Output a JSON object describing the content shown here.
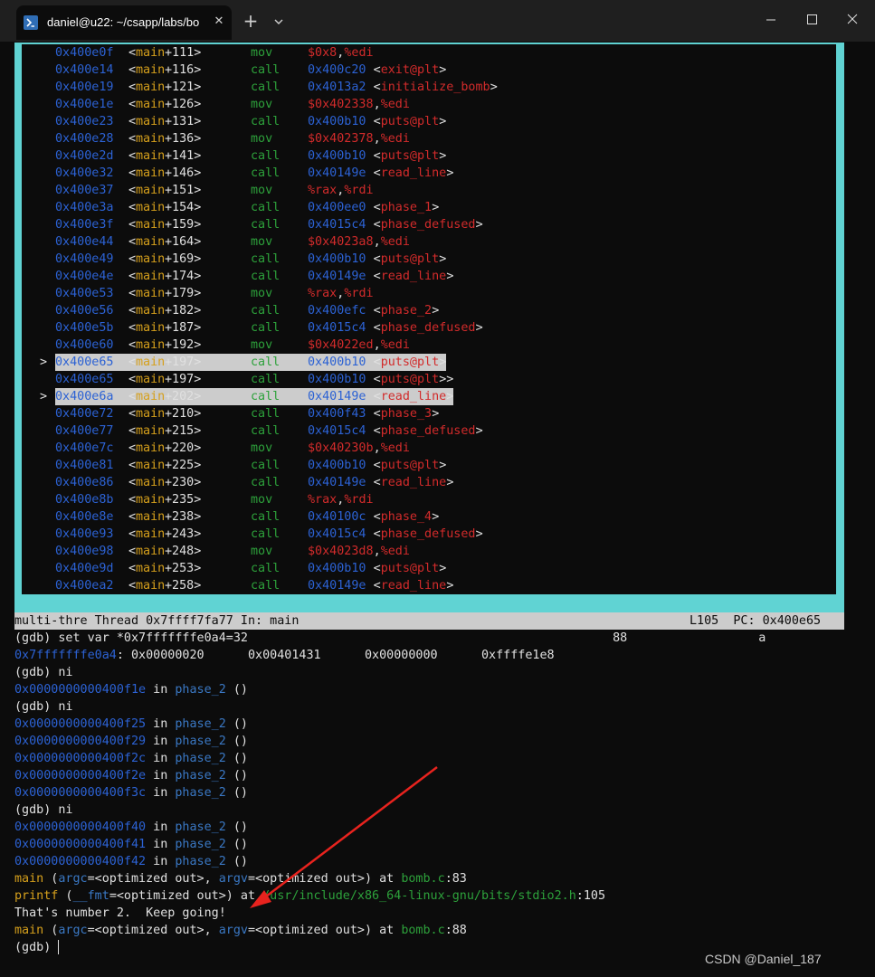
{
  "window": {
    "tab_title": "daniel@u22: ~/csapp/labs/bo",
    "new_tab_label": "+",
    "tab_close": "✕"
  },
  "asm_lines": [
    {
      "marker": "",
      "addr": "0x400e0f",
      "fn": "main",
      "off": "+111",
      "op": "mov",
      "args": [
        [
          "reg",
          "$0x8"
        ],
        [
          "w",
          ","
        ],
        [
          "reg",
          "%edi"
        ]
      ],
      "hl": false
    },
    {
      "marker": "",
      "addr": "0x400e14",
      "fn": "main",
      "off": "+116",
      "op": "call",
      "args": [
        [
          "addr",
          "0x400c20"
        ],
        [
          "w",
          " <"
        ],
        [
          "sym",
          "exit@plt"
        ],
        [
          "w",
          ">"
        ]
      ],
      "hl": false
    },
    {
      "marker": "",
      "addr": "0x400e19",
      "fn": "main",
      "off": "+121",
      "op": "call",
      "args": [
        [
          "addr",
          "0x4013a2"
        ],
        [
          "w",
          " <"
        ],
        [
          "sym",
          "initialize_bomb"
        ],
        [
          "w",
          ">"
        ]
      ],
      "hl": false
    },
    {
      "marker": "",
      "addr": "0x400e1e",
      "fn": "main",
      "off": "+126",
      "op": "mov",
      "args": [
        [
          "reg",
          "$0x402338"
        ],
        [
          "w",
          ","
        ],
        [
          "reg",
          "%edi"
        ]
      ],
      "hl": false
    },
    {
      "marker": "",
      "addr": "0x400e23",
      "fn": "main",
      "off": "+131",
      "op": "call",
      "args": [
        [
          "addr",
          "0x400b10"
        ],
        [
          "w",
          " <"
        ],
        [
          "sym",
          "puts@plt"
        ],
        [
          "w",
          ">"
        ]
      ],
      "hl": false
    },
    {
      "marker": "",
      "addr": "0x400e28",
      "fn": "main",
      "off": "+136",
      "op": "mov",
      "args": [
        [
          "reg",
          "$0x402378"
        ],
        [
          "w",
          ","
        ],
        [
          "reg",
          "%edi"
        ]
      ],
      "hl": false
    },
    {
      "marker": "",
      "addr": "0x400e2d",
      "fn": "main",
      "off": "+141",
      "op": "call",
      "args": [
        [
          "addr",
          "0x400b10"
        ],
        [
          "w",
          " <"
        ],
        [
          "sym",
          "puts@plt"
        ],
        [
          "w",
          ">"
        ]
      ],
      "hl": false
    },
    {
      "marker": "",
      "addr": "0x400e32",
      "fn": "main",
      "off": "+146",
      "op": "call",
      "args": [
        [
          "addr",
          "0x40149e"
        ],
        [
          "w",
          " <"
        ],
        [
          "sym",
          "read_line"
        ],
        [
          "w",
          ">"
        ]
      ],
      "hl": false
    },
    {
      "marker": "",
      "addr": "0x400e37",
      "fn": "main",
      "off": "+151",
      "op": "mov",
      "args": [
        [
          "reg",
          "%rax"
        ],
        [
          "w",
          ","
        ],
        [
          "reg",
          "%rdi"
        ]
      ],
      "hl": false
    },
    {
      "marker": "",
      "addr": "0x400e3a",
      "fn": "main",
      "off": "+154",
      "op": "call",
      "args": [
        [
          "addr",
          "0x400ee0"
        ],
        [
          "w",
          " <"
        ],
        [
          "sym",
          "phase_1"
        ],
        [
          "w",
          ">"
        ]
      ],
      "hl": false
    },
    {
      "marker": "",
      "addr": "0x400e3f",
      "fn": "main",
      "off": "+159",
      "op": "call",
      "args": [
        [
          "addr",
          "0x4015c4"
        ],
        [
          "w",
          " <"
        ],
        [
          "sym",
          "phase_defused"
        ],
        [
          "w",
          ">"
        ]
      ],
      "hl": false
    },
    {
      "marker": "",
      "addr": "0x400e44",
      "fn": "main",
      "off": "+164",
      "op": "mov",
      "args": [
        [
          "reg",
          "$0x4023a8"
        ],
        [
          "w",
          ","
        ],
        [
          "reg",
          "%edi"
        ]
      ],
      "hl": false
    },
    {
      "marker": "",
      "addr": "0x400e49",
      "fn": "main",
      "off": "+169",
      "op": "call",
      "args": [
        [
          "addr",
          "0x400b10"
        ],
        [
          "w",
          " <"
        ],
        [
          "sym",
          "puts@plt"
        ],
        [
          "w",
          ">"
        ]
      ],
      "hl": false
    },
    {
      "marker": "",
      "addr": "0x400e4e",
      "fn": "main",
      "off": "+174",
      "op": "call",
      "args": [
        [
          "addr",
          "0x40149e"
        ],
        [
          "w",
          " <"
        ],
        [
          "sym",
          "read_line"
        ],
        [
          "w",
          ">"
        ]
      ],
      "hl": false
    },
    {
      "marker": "",
      "addr": "0x400e53",
      "fn": "main",
      "off": "+179",
      "op": "mov",
      "args": [
        [
          "reg",
          "%rax"
        ],
        [
          "w",
          ","
        ],
        [
          "reg",
          "%rdi"
        ]
      ],
      "hl": false
    },
    {
      "marker": "",
      "addr": "0x400e56",
      "fn": "main",
      "off": "+182",
      "op": "call",
      "args": [
        [
          "addr",
          "0x400efc"
        ],
        [
          "w",
          " <"
        ],
        [
          "sym",
          "phase_2"
        ],
        [
          "w",
          ">"
        ]
      ],
      "hl": false
    },
    {
      "marker": "",
      "addr": "0x400e5b",
      "fn": "main",
      "off": "+187",
      "op": "call",
      "args": [
        [
          "addr",
          "0x4015c4"
        ],
        [
          "w",
          " <"
        ],
        [
          "sym",
          "phase_defused"
        ],
        [
          "w",
          ">"
        ]
      ],
      "hl": false
    },
    {
      "marker": "",
      "addr": "0x400e60",
      "fn": "main",
      "off": "+192",
      "op": "mov",
      "args": [
        [
          "reg",
          "$0x4022ed"
        ],
        [
          "w",
          ","
        ],
        [
          "reg",
          "%edi"
        ]
      ],
      "hl": false
    },
    {
      "marker": ">",
      "addr": "0x400e65",
      "fn": "main",
      "off": "+197",
      "op": "call",
      "args": [
        [
          "addr",
          "0x400b10"
        ],
        [
          "w",
          " <"
        ],
        [
          "sym",
          "puts@plt"
        ],
        [
          "w",
          ">"
        ]
      ],
      "hl": true
    },
    {
      "marker": "",
      "addr": "0x400e65",
      "fn": "main",
      "off": "+197",
      "op": "call",
      "args": [
        [
          "addr",
          "0x400b10"
        ],
        [
          "w",
          " <"
        ],
        [
          "sym",
          "puts@plt"
        ],
        [
          "w",
          ">>"
        ]
      ],
      "hl": false
    },
    {
      "marker": ">",
      "addr": "0x400e6a",
      "fn": "main",
      "off": "+202",
      "op": "call",
      "args": [
        [
          "addr",
          "0x40149e"
        ],
        [
          "w",
          " <"
        ],
        [
          "sym",
          "read_line"
        ],
        [
          "w",
          ">"
        ]
      ],
      "hl": true
    },
    {
      "marker": "",
      "addr": "0x400e72",
      "fn": "main",
      "off": "+210",
      "op": "call",
      "args": [
        [
          "addr",
          "0x400f43"
        ],
        [
          "w",
          " <"
        ],
        [
          "sym",
          "phase_3"
        ],
        [
          "w",
          ">"
        ]
      ],
      "hl": false
    },
    {
      "marker": "",
      "addr": "0x400e77",
      "fn": "main",
      "off": "+215",
      "op": "call",
      "args": [
        [
          "addr",
          "0x4015c4"
        ],
        [
          "w",
          " <"
        ],
        [
          "sym",
          "phase_defused"
        ],
        [
          "w",
          ">"
        ]
      ],
      "hl": false
    },
    {
      "marker": "",
      "addr": "0x400e7c",
      "fn": "main",
      "off": "+220",
      "op": "mov",
      "args": [
        [
          "reg",
          "$0x40230b"
        ],
        [
          "w",
          ","
        ],
        [
          "reg",
          "%edi"
        ]
      ],
      "hl": false
    },
    {
      "marker": "",
      "addr": "0x400e81",
      "fn": "main",
      "off": "+225",
      "op": "call",
      "args": [
        [
          "addr",
          "0x400b10"
        ],
        [
          "w",
          " <"
        ],
        [
          "sym",
          "puts@plt"
        ],
        [
          "w",
          ">"
        ]
      ],
      "hl": false
    },
    {
      "marker": "",
      "addr": "0x400e86",
      "fn": "main",
      "off": "+230",
      "op": "call",
      "args": [
        [
          "addr",
          "0x40149e"
        ],
        [
          "w",
          " <"
        ],
        [
          "sym",
          "read_line"
        ],
        [
          "w",
          ">"
        ]
      ],
      "hl": false
    },
    {
      "marker": "",
      "addr": "0x400e8b",
      "fn": "main",
      "off": "+235",
      "op": "mov",
      "args": [
        [
          "reg",
          "%rax"
        ],
        [
          "w",
          ","
        ],
        [
          "reg",
          "%rdi"
        ]
      ],
      "hl": false
    },
    {
      "marker": "",
      "addr": "0x400e8e",
      "fn": "main",
      "off": "+238",
      "op": "call",
      "args": [
        [
          "addr",
          "0x40100c"
        ],
        [
          "w",
          " <"
        ],
        [
          "sym",
          "phase_4"
        ],
        [
          "w",
          ">"
        ]
      ],
      "hl": false
    },
    {
      "marker": "",
      "addr": "0x400e93",
      "fn": "main",
      "off": "+243",
      "op": "call",
      "args": [
        [
          "addr",
          "0x4015c4"
        ],
        [
          "w",
          " <"
        ],
        [
          "sym",
          "phase_defused"
        ],
        [
          "w",
          ">"
        ]
      ],
      "hl": false
    },
    {
      "marker": "",
      "addr": "0x400e98",
      "fn": "main",
      "off": "+248",
      "op": "mov",
      "args": [
        [
          "reg",
          "$0x4023d8"
        ],
        [
          "w",
          ","
        ],
        [
          "reg",
          "%edi"
        ]
      ],
      "hl": false
    },
    {
      "marker": "",
      "addr": "0x400e9d",
      "fn": "main",
      "off": "+253",
      "op": "call",
      "args": [
        [
          "addr",
          "0x400b10"
        ],
        [
          "w",
          " <"
        ],
        [
          "sym",
          "puts@plt"
        ],
        [
          "w",
          ">"
        ]
      ],
      "hl": false
    },
    {
      "marker": "",
      "addr": "0x400ea2",
      "fn": "main",
      "off": "+258",
      "op": "call",
      "args": [
        [
          "addr",
          "0x40149e"
        ],
        [
          "w",
          " <"
        ],
        [
          "sym",
          "read_line"
        ],
        [
          "w",
          ">"
        ]
      ],
      "hl": false
    }
  ],
  "status": {
    "left": "multi-thre Thread 0x7ffff7fa77 In: main",
    "right": "L105  PC: 0x400e65"
  },
  "console_lines": [
    [
      [
        "w",
        "(gdb) set var *0x7fffffffe0a4=32                                                  88                  a"
      ]
    ],
    [
      [
        "blue",
        "0x7fffffffe0a4"
      ],
      [
        "w",
        ": 0x00000020      0x00401431      0x00000000      0xffffe1e8"
      ]
    ],
    [
      [
        "w",
        "(gdb) ni"
      ]
    ],
    [
      [
        "blue",
        "0x0000000000400f1e"
      ],
      [
        "w",
        " in "
      ],
      [
        "cyan",
        "phase_2"
      ],
      [
        "w",
        " ()"
      ]
    ],
    [
      [
        "w",
        "(gdb) ni"
      ]
    ],
    [
      [
        "blue",
        "0x0000000000400f25"
      ],
      [
        "w",
        " in "
      ],
      [
        "cyan",
        "phase_2"
      ],
      [
        "w",
        " ()"
      ]
    ],
    [
      [
        "blue",
        "0x0000000000400f29"
      ],
      [
        "w",
        " in "
      ],
      [
        "cyan",
        "phase_2"
      ],
      [
        "w",
        " ()"
      ]
    ],
    [
      [
        "blue",
        "0x0000000000400f2c"
      ],
      [
        "w",
        " in "
      ],
      [
        "cyan",
        "phase_2"
      ],
      [
        "w",
        " ()"
      ]
    ],
    [
      [
        "blue",
        "0x0000000000400f2e"
      ],
      [
        "w",
        " in "
      ],
      [
        "cyan",
        "phase_2"
      ],
      [
        "w",
        " ()"
      ]
    ],
    [
      [
        "blue",
        "0x0000000000400f3c"
      ],
      [
        "w",
        " in "
      ],
      [
        "cyan",
        "phase_2"
      ],
      [
        "w",
        " ()"
      ]
    ],
    [
      [
        "w",
        "(gdb) ni"
      ]
    ],
    [
      [
        "blue",
        "0x0000000000400f40"
      ],
      [
        "w",
        " in "
      ],
      [
        "cyan",
        "phase_2"
      ],
      [
        "w",
        " ()"
      ]
    ],
    [
      [
        "blue",
        "0x0000000000400f41"
      ],
      [
        "w",
        " in "
      ],
      [
        "cyan",
        "phase_2"
      ],
      [
        "w",
        " ()"
      ]
    ],
    [
      [
        "blue",
        "0x0000000000400f42"
      ],
      [
        "w",
        " in "
      ],
      [
        "cyan",
        "phase_2"
      ],
      [
        "w",
        " ()"
      ]
    ],
    [
      [
        "gold",
        "main"
      ],
      [
        "w",
        " ("
      ],
      [
        "cyan",
        "argc"
      ],
      [
        "w",
        "=<optimized out>, "
      ],
      [
        "cyan",
        "argv"
      ],
      [
        "w",
        "=<optimized out>) at "
      ],
      [
        "path",
        "bomb.c"
      ],
      [
        "w",
        ":83"
      ]
    ],
    [
      [
        "gold",
        "printf"
      ],
      [
        "w",
        " ("
      ],
      [
        "cyan",
        "__fmt"
      ],
      [
        "w",
        "=<optimized out>) at "
      ],
      [
        "path",
        "/usr/include/x86_64-linux-gnu/bits/stdio2.h"
      ],
      [
        "w",
        ":105"
      ]
    ],
    [
      [
        "w",
        "That's number 2.  Keep going!"
      ]
    ],
    [
      [
        "gold",
        "main"
      ],
      [
        "w",
        " ("
      ],
      [
        "cyan",
        "argc"
      ],
      [
        "w",
        "=<optimized out>, "
      ],
      [
        "cyan",
        "argv"
      ],
      [
        "w",
        "=<optimized out>) at "
      ],
      [
        "path",
        "bomb.c"
      ],
      [
        "w",
        ":88"
      ]
    ],
    [
      [
        "w",
        "(gdb) "
      ]
    ]
  ],
  "watermark": "CSDN @Daniel_187",
  "colors": {
    "frame": "#60d3d3",
    "address": "#2c62d4",
    "function": "#d6a01c",
    "opcode": "#2da13b",
    "operand": "#d22b2b",
    "annotation_arrow": "#e8231e"
  }
}
